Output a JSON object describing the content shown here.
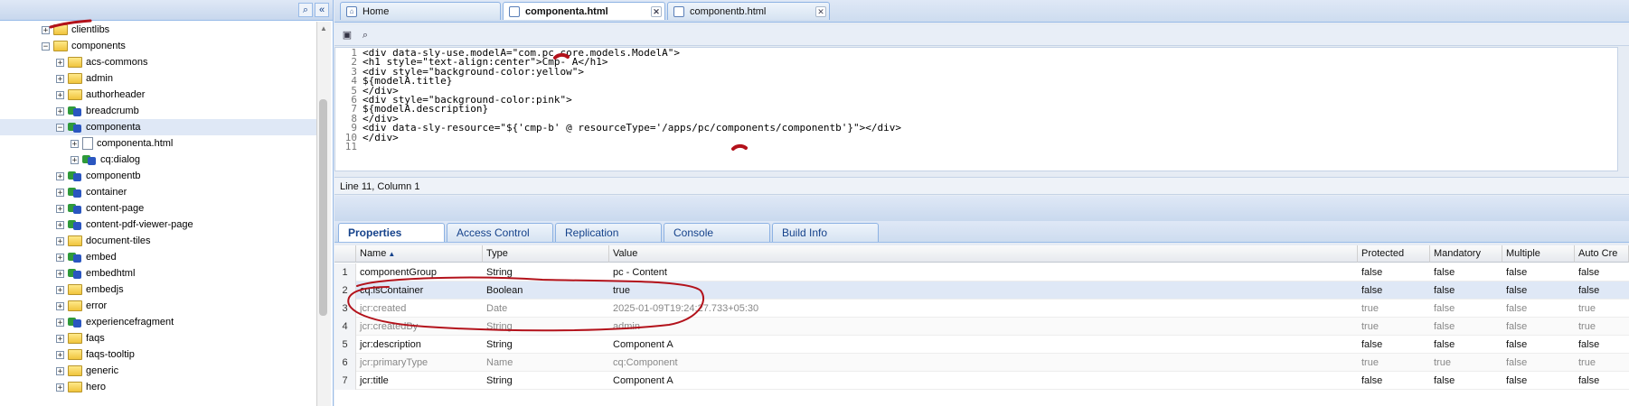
{
  "tree": {
    "items": [
      {
        "label": "clientlibs",
        "icon": "folder-icon",
        "depth": 1,
        "expander": "+"
      },
      {
        "label": "components",
        "icon": "folder-icon",
        "depth": 1,
        "expander": "−"
      },
      {
        "label": "acs-commons",
        "icon": "folder-icon",
        "depth": 2,
        "expander": "+"
      },
      {
        "label": "admin",
        "icon": "folder-icon",
        "depth": 2,
        "expander": "+"
      },
      {
        "label": "authorheader",
        "icon": "folder-icon",
        "depth": 2,
        "expander": "+"
      },
      {
        "label": "breadcrumb",
        "icon": "component-icon",
        "depth": 2,
        "expander": "+"
      },
      {
        "label": "componenta",
        "icon": "component-icon",
        "depth": 2,
        "expander": "−"
      },
      {
        "label": "componenta.html",
        "icon": "file-icon",
        "depth": 3,
        "expander": "+"
      },
      {
        "label": "cq:dialog",
        "icon": "component-icon",
        "depth": 3,
        "expander": "+"
      },
      {
        "label": "componentb",
        "icon": "component-icon",
        "depth": 2,
        "expander": "+"
      },
      {
        "label": "container",
        "icon": "component-icon",
        "depth": 2,
        "expander": "+"
      },
      {
        "label": "content-page",
        "icon": "component-icon",
        "depth": 2,
        "expander": "+"
      },
      {
        "label": "content-pdf-viewer-page",
        "icon": "component-icon",
        "depth": 2,
        "expander": "+"
      },
      {
        "label": "document-tiles",
        "icon": "folder-icon",
        "depth": 2,
        "expander": "+"
      },
      {
        "label": "embed",
        "icon": "component-icon",
        "depth": 2,
        "expander": "+"
      },
      {
        "label": "embedhtml",
        "icon": "component-icon",
        "depth": 2,
        "expander": "+"
      },
      {
        "label": "embedjs",
        "icon": "folder-icon",
        "depth": 2,
        "expander": "+"
      },
      {
        "label": "error",
        "icon": "folder-icon",
        "depth": 2,
        "expander": "+"
      },
      {
        "label": "experiencefragment",
        "icon": "component-icon",
        "depth": 2,
        "expander": "+"
      },
      {
        "label": "faqs",
        "icon": "folder-icon",
        "depth": 2,
        "expander": "+"
      },
      {
        "label": "faqs-tooltip",
        "icon": "folder-icon",
        "depth": 2,
        "expander": "+"
      },
      {
        "label": "generic",
        "icon": "folder-icon",
        "depth": 2,
        "expander": "+"
      },
      {
        "label": "hero",
        "icon": "folder-icon",
        "depth": 2,
        "expander": "+"
      }
    ],
    "header_buttons": {
      "find": "⌕",
      "collapse": "«"
    }
  },
  "tabs": [
    {
      "label": "Home",
      "icon": "home-icon"
    },
    {
      "label": "componenta.html",
      "icon": "file-icon",
      "closable": "✕"
    },
    {
      "label": "componentb.html",
      "icon": "file-icon",
      "closable": "✕"
    }
  ],
  "toolbar": {
    "save": "▣",
    "find": "⌕"
  },
  "editor": {
    "lines": [
      {
        "n": "1",
        "code": "<div data-sly-use.modelA=\"com.pc.core.models.ModelA\">"
      },
      {
        "n": "2",
        "code": "<h1 style=\"text-align:center\">Cmp- A</h1>"
      },
      {
        "n": "3",
        "code": "<div style=\"background-color:yellow\">"
      },
      {
        "n": "4",
        "code": "${modelA.title}"
      },
      {
        "n": "5",
        "code": "</div>"
      },
      {
        "n": "6",
        "code": "<div style=\"background-color:pink\">"
      },
      {
        "n": "7",
        "code": "${modelA.description}"
      },
      {
        "n": "8",
        "code": "</div>"
      },
      {
        "n": "9",
        "code": "<div data-sly-resource=\"${'cmp-b' @ resourceType='/apps/pc/components/componentb'}\"></div>"
      },
      {
        "n": "10",
        "code": "</div>"
      },
      {
        "n": "11",
        "code": ""
      }
    ]
  },
  "status": "Line 11, Column 1",
  "bottom_tabs": [
    "Properties",
    "Access Control",
    "Replication",
    "Console",
    "Build Info"
  ],
  "grid": {
    "headers": [
      "Name",
      "Type",
      "Value",
      "Protected",
      "Mandatory",
      "Multiple",
      "Auto Cre"
    ],
    "sort_indicator": "▲",
    "rows": [
      {
        "n": "1",
        "name": "componentGroup",
        "type": "String",
        "value": "pc - Content",
        "protected": "false",
        "mandatory": "false",
        "multiple": "false",
        "auto": "false",
        "dim": false
      },
      {
        "n": "2",
        "name": "cq:isContainer",
        "type": "Boolean",
        "value": "true",
        "protected": "false",
        "mandatory": "false",
        "multiple": "false",
        "auto": "false",
        "dim": false
      },
      {
        "n": "3",
        "name": "jcr:created",
        "type": "Date",
        "value": "2025-01-09T19:24:27.733+05:30",
        "protected": "true",
        "mandatory": "false",
        "multiple": "false",
        "auto": "true",
        "dim": true
      },
      {
        "n": "4",
        "name": "jcr:createdBy",
        "type": "String",
        "value": "admin",
        "protected": "true",
        "mandatory": "false",
        "multiple": "false",
        "auto": "true",
        "dim": true
      },
      {
        "n": "5",
        "name": "jcr:description",
        "type": "String",
        "value": "Component A",
        "protected": "false",
        "mandatory": "false",
        "multiple": "false",
        "auto": "false",
        "dim": false
      },
      {
        "n": "6",
        "name": "jcr:primaryType",
        "type": "Name",
        "value": "cq:Component",
        "protected": "true",
        "mandatory": "true",
        "multiple": "false",
        "auto": "true",
        "dim": true
      },
      {
        "n": "7",
        "name": "jcr:title",
        "type": "String",
        "value": "Component A",
        "protected": "false",
        "mandatory": "false",
        "multiple": "false",
        "auto": "false",
        "dim": false
      }
    ]
  },
  "colors": {
    "annotation": "#b3121b",
    "selection": "#dfe8f6",
    "border": "#99bbe8"
  }
}
